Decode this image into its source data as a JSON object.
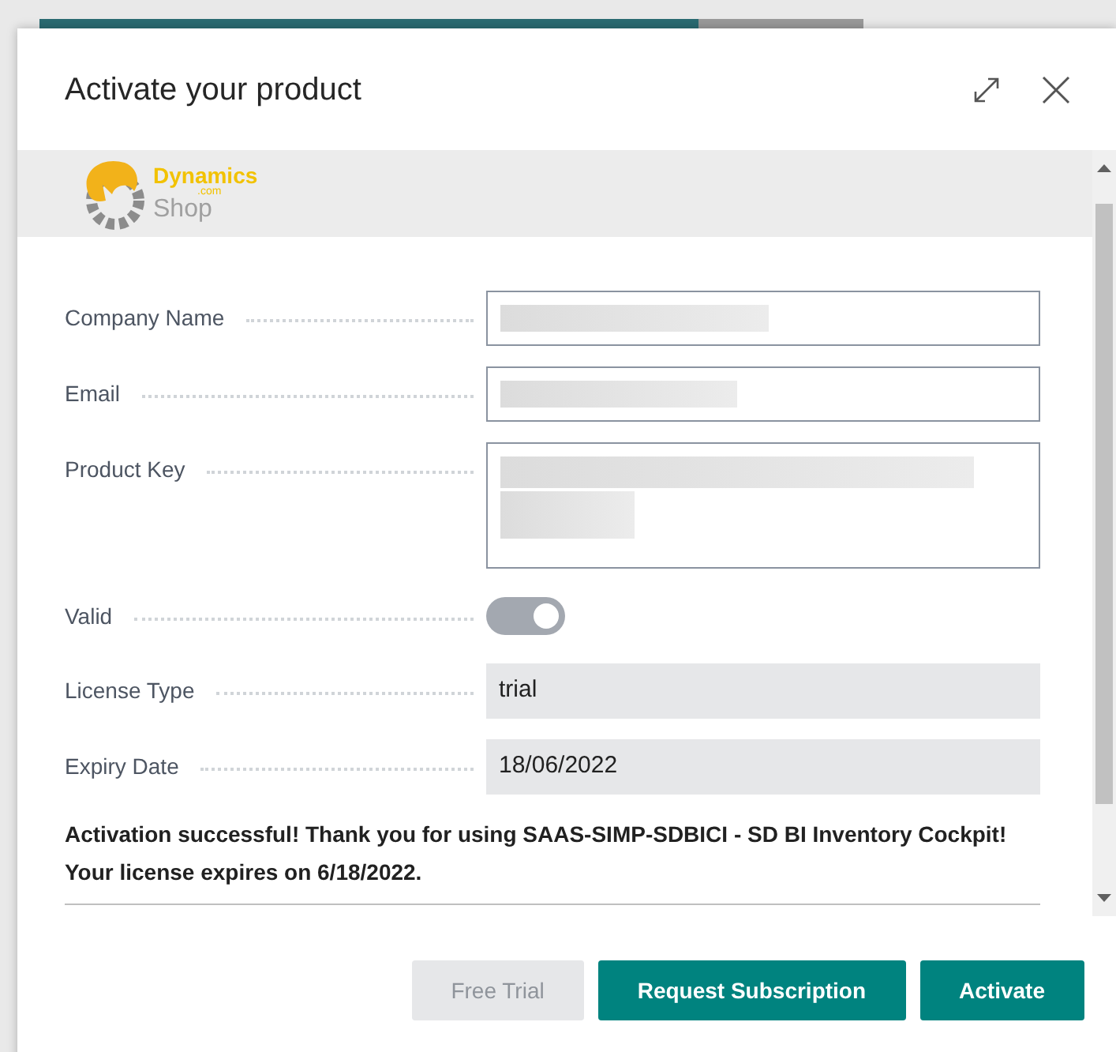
{
  "dialog": {
    "title": "Activate your product"
  },
  "logo": {
    "name": "Dynamics",
    "suffix": ".com",
    "subname": "Shop"
  },
  "fields": [
    {
      "kind": "text",
      "label": "Company Name",
      "blurred": true
    },
    {
      "kind": "text",
      "label": "Email",
      "blurred": true
    },
    {
      "kind": "textarea",
      "label": "Product Key",
      "blurred": true
    },
    {
      "kind": "toggle",
      "label": "Valid",
      "on": true,
      "disabled": true
    },
    {
      "kind": "readonly",
      "label": "License Type",
      "value": "trial"
    },
    {
      "kind": "readonly",
      "label": "Expiry Date",
      "value": "18/06/2022"
    }
  ],
  "message": [
    "Activation successful! Thank you for using SAAS-SIMP-SDBICI - SD BI Inventory Cockpit!",
    "Your license expires on 6/18/2022."
  ],
  "buttons": [
    {
      "label": "Free Trial",
      "disabled": true
    },
    {
      "label": "Request Subscription",
      "disabled": false
    },
    {
      "label": "Activate",
      "disabled": false
    }
  ]
}
